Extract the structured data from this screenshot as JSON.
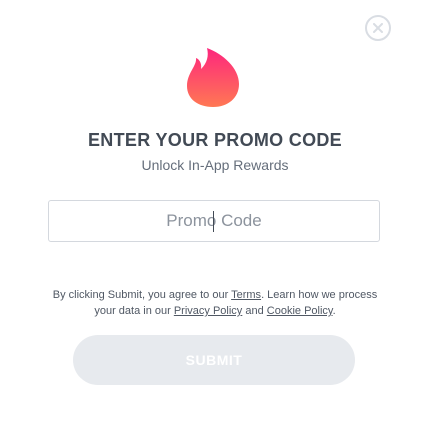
{
  "colors": {
    "flame_top": "#fd267d",
    "flame_bottom": "#ff7854",
    "title": "#424a55",
    "submit_disabled_bg": "#e7eaee"
  },
  "icons": {
    "close": "close-icon",
    "logo": "flame-icon"
  },
  "header": {
    "title": "ENTER YOUR PROMO CODE",
    "subtitle": "Unlock In-App Rewards"
  },
  "promo_input": {
    "placeholder": "Promo Code",
    "value": ""
  },
  "legal": {
    "text_before_terms": "By clicking Submit, you agree to our ",
    "terms_link": "Terms",
    "text_after_terms": ". Learn how we process your data in our ",
    "privacy_link": "Privacy Policy",
    "and_text": " and ",
    "cookie_link": "Cookie Policy",
    "period": "."
  },
  "submit": {
    "label": "SUBMIT",
    "enabled": false
  }
}
